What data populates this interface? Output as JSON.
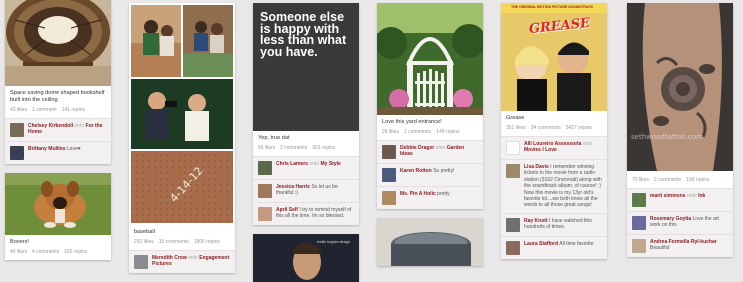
{
  "columns": [
    {
      "pins": [
        {
          "image": "dome bookshelf room",
          "desc": "Space saving dome shaped bookshelf built into the ceiling",
          "likes": "43 likes",
          "comments": "1 comment",
          "repins": "141 repins",
          "activity": [
            {
              "user": "Chelsey Kirkendoll",
              "onto": "onto",
              "board": "For the Home",
              "text": ""
            },
            {
              "user": "Brittany Mullins",
              "onto": "",
              "board": "",
              "text": "Love♥"
            }
          ]
        },
        {
          "image": "boxer puppy on grass",
          "desc": "Boxers!",
          "likes": "46 likes",
          "comments": "4 comments",
          "repins": "162 repins"
        }
      ]
    },
    {
      "pins": [
        {
          "image": "baseball engagement collage",
          "date_text": "4-14-12",
          "desc": "baseball",
          "likes": "292 likes",
          "comments": "10 comments",
          "repins": "1806 repins",
          "activity": [
            {
              "user": "Meredith Crow",
              "onto": "onto",
              "board": "Engagement Pictures",
              "text": ""
            }
          ]
        }
      ]
    },
    {
      "pins": [
        {
          "image": "quote card",
          "quote": "Someone else is happy with less than what you have.",
          "desc": "Yep, true dat",
          "likes": "56 likes",
          "comments": "2 comments",
          "repins": "301 repins",
          "activity": [
            {
              "user": "Chris Lamers",
              "onto": "onto",
              "board": "My Style",
              "text": ""
            },
            {
              "user": "Jessica Harris",
              "onto": "",
              "board": "",
              "text": "So let us be thankful.:)"
            },
            {
              "user": "April Self",
              "onto": "",
              "board": "",
              "text": "I try to remind myself of this all the time. Im so blessed."
            }
          ]
        },
        {
          "image": "man portrait",
          "caption_small": "emilie hughes design"
        }
      ]
    },
    {
      "pins": [
        {
          "image": "garden gate",
          "desc": "Love this yard entrance!",
          "likes": "28 likes",
          "comments": "2 comments",
          "repins": "149 repins",
          "activity": [
            {
              "user": "Debbie Drager",
              "onto": "onto",
              "board": "Garden Ideas",
              "text": ""
            },
            {
              "user": "Karen Rotton",
              "onto": "",
              "board": "",
              "text": "So pretty!"
            },
            {
              "user": "Ms. Pin A Holic",
              "onto": "",
              "board": "",
              "text": "pretty"
            }
          ]
        },
        {
          "image": "grey bowl"
        }
      ]
    },
    {
      "pins": [
        {
          "image": "grease poster",
          "poster_top": "THE ORIGINAL MOTION PICTURE SOUNDTRACK",
          "poster_logo": "GREASE",
          "desc": "Grease",
          "likes": "351 likes",
          "comments": "34 comments",
          "repins": "3427 repins",
          "activity": [
            {
              "user": "Alli Loureiro Assessoria",
              "onto": "onto",
              "board": "Movies I Love",
              "text": ""
            },
            {
              "user": "Lisa Davis",
              "onto": "",
              "board": "",
              "text": "I remember winning tickets to the movie from a radio station (3102 Cincinnati) along with the soundtrack album, of course! :) Now this movie is my 13yr old's favorite lol....we both know all the words to all those great songs!"
            },
            {
              "user": "Ray Knott",
              "onto": "",
              "board": "",
              "text": "I have watched this hundreds of times."
            },
            {
              "user": "Laura Stafford",
              "onto": "",
              "board": "",
              "text": "All time favorite"
            }
          ]
        }
      ]
    },
    {
      "pins": [
        {
          "image": "rose tattoo arm",
          "watermark": "sethwoodtattoo.com",
          "likes": "70 likes",
          "comments": "2 comments",
          "repins": "199 repins",
          "activity": [
            {
              "user": "marti simmons",
              "onto": "onto",
              "board": "Ink",
              "text": ""
            },
            {
              "user": "Rosemary Goytia",
              "onto": "",
              "board": "",
              "text": "Love the art work on this"
            },
            {
              "user": "Andrea Formella Ryl-kuchar",
              "onto": "",
              "board": "",
              "text": "Beautiful"
            }
          ]
        }
      ]
    }
  ],
  "colors": {
    "background": "#e9e7e7",
    "username": "#8a1e22",
    "comment_bg": "#f2f0f0"
  }
}
